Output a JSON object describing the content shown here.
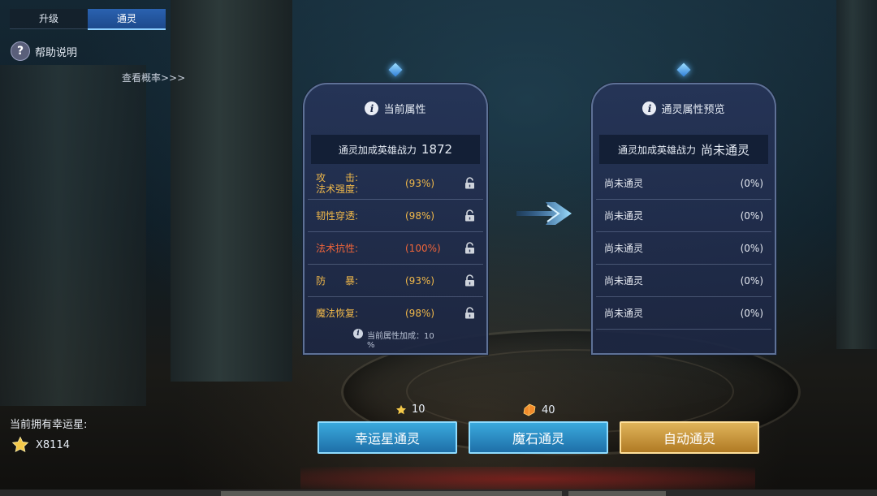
{
  "tabs": [
    {
      "label": "升级",
      "active": false
    },
    {
      "label": "通灵",
      "active": true
    }
  ],
  "help": {
    "label": "帮助说明"
  },
  "probability_link": "查看概率>>>",
  "current_panel": {
    "title": "当前属性",
    "power_label": "通灵加成英雄战力",
    "power_value": "1872",
    "attributes": [
      {
        "name": "攻　　击:\n法术强度:",
        "percent": "(93%)",
        "color": "#f0b84a"
      },
      {
        "name": "韧性穿透:",
        "percent": "(98%)",
        "color": "#f0b84a"
      },
      {
        "name": "法术抗性:",
        "percent": "(100%)",
        "color": "#f0653a"
      },
      {
        "name": "防　　暴:",
        "percent": "(93%)",
        "color": "#f0b84a"
      },
      {
        "name": "魔法恢复:",
        "percent": "(98%)",
        "color": "#f0b84a"
      }
    ],
    "footnote": "当前属性加成：10\n%"
  },
  "preview_panel": {
    "title": "通灵属性预览",
    "power_label": "通灵加成英雄战力",
    "power_value": "尚未通灵",
    "rows": [
      {
        "name": "尚未通灵",
        "percent": "(0%)"
      },
      {
        "name": "尚未通灵",
        "percent": "(0%)"
      },
      {
        "name": "尚未通灵",
        "percent": "(0%)"
      },
      {
        "name": "尚未通灵",
        "percent": "(0%)"
      },
      {
        "name": "尚未通灵",
        "percent": "(0%)"
      }
    ]
  },
  "lucky_star": {
    "label": "当前拥有幸运星:",
    "count": "X8114"
  },
  "costs": {
    "star_cost": "10",
    "stone_cost": "40"
  },
  "buttons": {
    "star": "幸运星通灵",
    "stone": "魔石通灵",
    "auto": "自动通灵"
  },
  "colors": {
    "accent_blue": "#2a62b0",
    "gold": "#f0b84a",
    "red": "#f0653a"
  }
}
